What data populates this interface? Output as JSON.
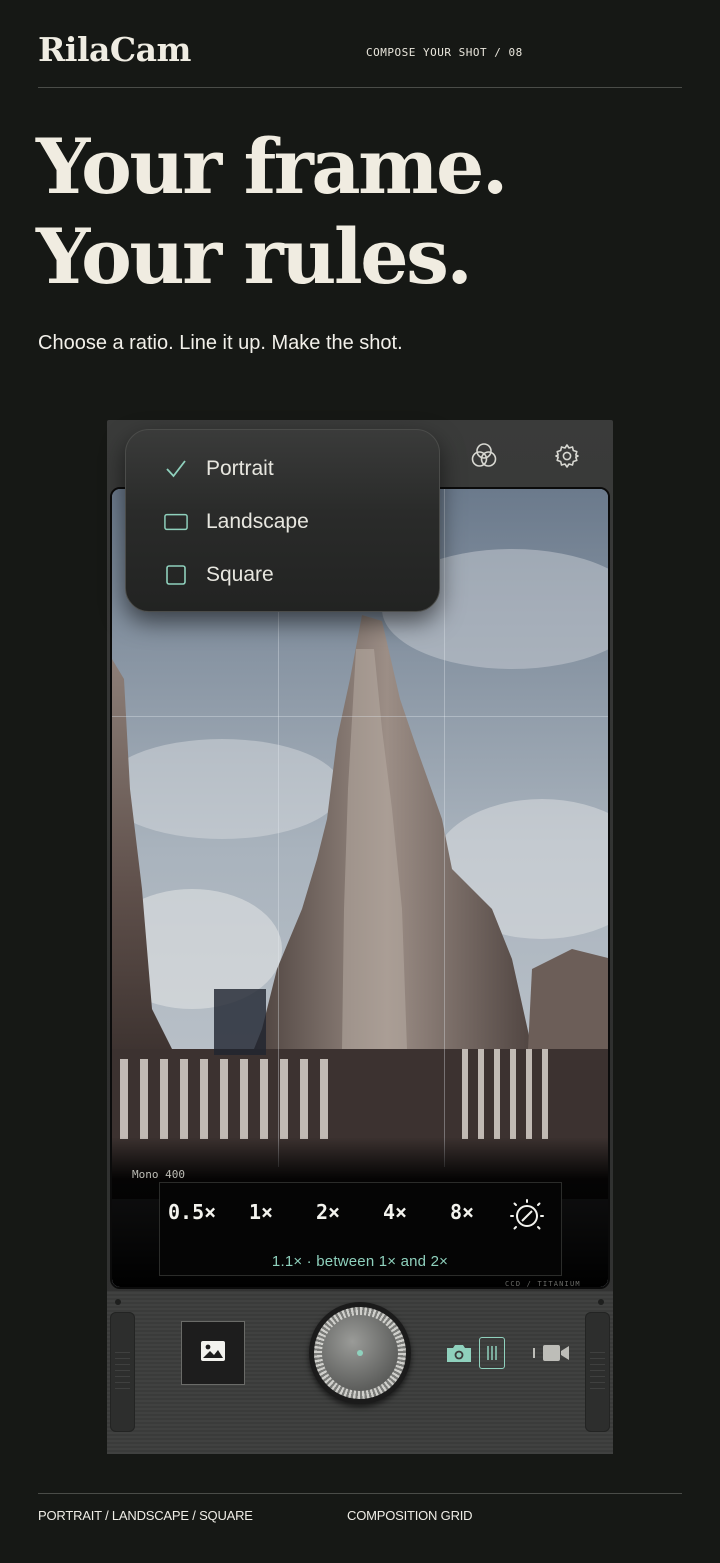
{
  "header": {
    "brand": "RilaCam",
    "kicker": "COMPOSE YOUR SHOT / 08"
  },
  "hero": {
    "line1": "Your frame.",
    "line2": "Your rules.",
    "tagline": "Choose a ratio. Line it up. Make the shot."
  },
  "camera": {
    "top_icons": [
      "filters-icon",
      "gear-icon"
    ],
    "ratio_menu": {
      "items": [
        {
          "label": "Portrait",
          "selected": true
        },
        {
          "label": "Landscape",
          "selected": false
        },
        {
          "label": "Square",
          "selected": false
        }
      ]
    },
    "film_label": "Mono 400",
    "zoom_levels": [
      "0.5×",
      "1×",
      "2×",
      "4×",
      "8×"
    ],
    "zoom_caption": "1.1× · between 1× and 2×",
    "sensor_label": "CCD / TITANIUM",
    "accent": "#8fd1bd",
    "modes": [
      "photo",
      "video"
    ]
  },
  "footer": {
    "left": "PORTRAIT / LANDSCAPE / SQUARE",
    "right": "COMPOSITION GRID"
  }
}
